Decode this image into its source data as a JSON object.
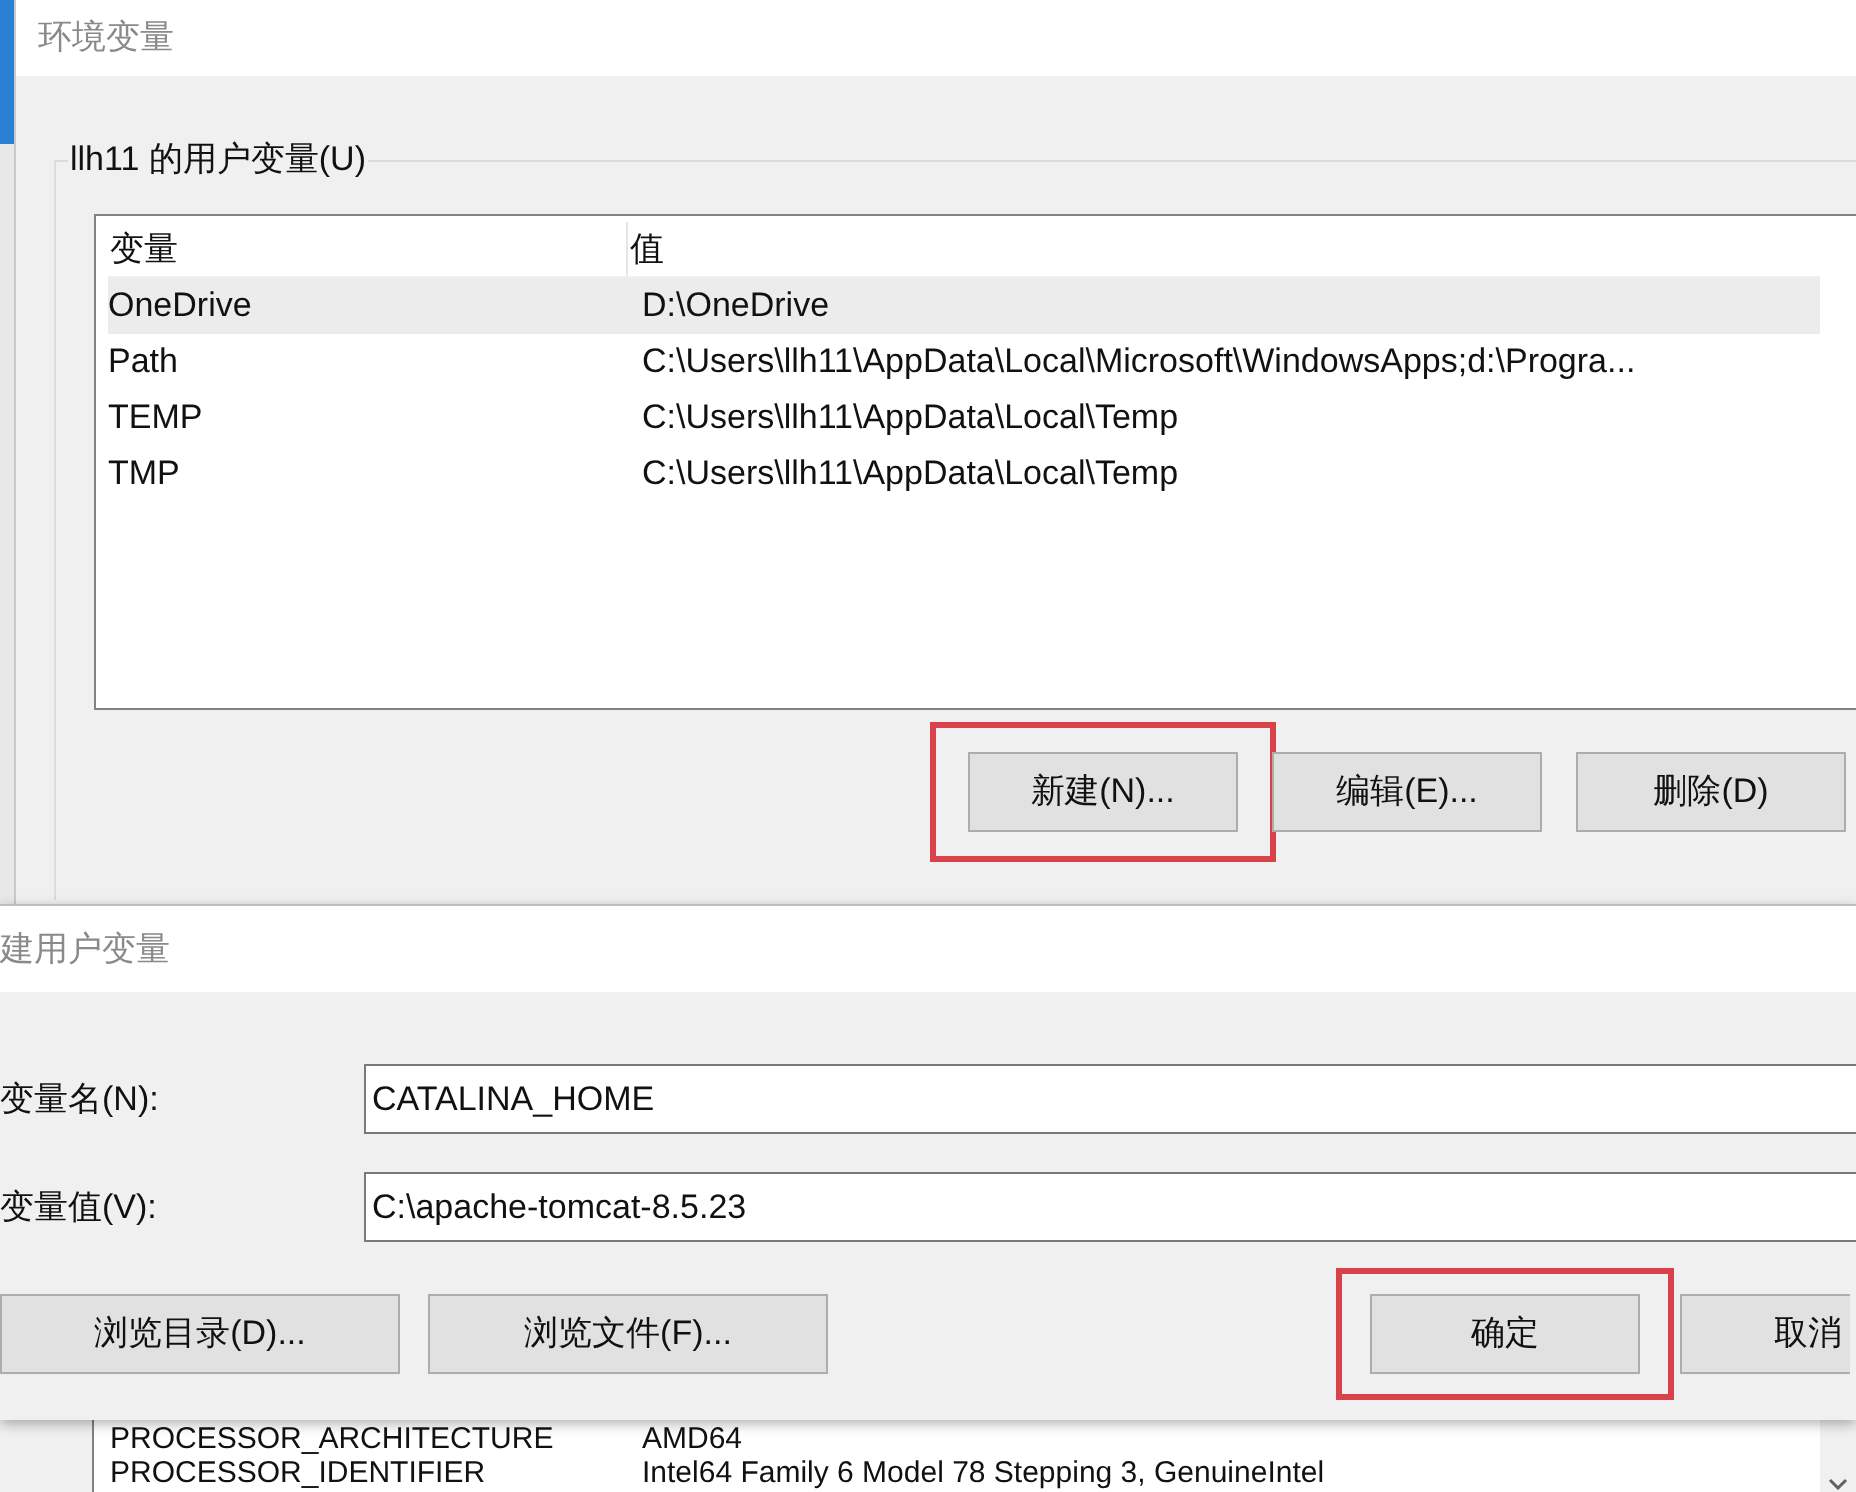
{
  "main_window": {
    "title": "环境变量",
    "group_label": "llh11 的用户变量(U)",
    "table": {
      "columns": [
        "变量",
        "值"
      ],
      "rows": [
        {
          "cells": [
            "OneDrive",
            "D:\\OneDrive"
          ],
          "selected": true
        },
        {
          "cells": [
            "Path",
            "C:\\Users\\llh11\\AppData\\Local\\Microsoft\\WindowsApps;d:\\Progra..."
          ],
          "selected": false
        },
        {
          "cells": [
            "TEMP",
            "C:\\Users\\llh11\\AppData\\Local\\Temp"
          ],
          "selected": false
        },
        {
          "cells": [
            "TMP",
            "C:\\Users\\llh11\\AppData\\Local\\Temp"
          ],
          "selected": false
        }
      ]
    },
    "buttons": [
      {
        "label": "新建(N)...",
        "highlighted": true
      },
      {
        "label": "编辑(E)...",
        "highlighted": false
      },
      {
        "label": "删除(D)",
        "highlighted": false
      }
    ]
  },
  "dialog": {
    "title": "建用户变量",
    "fields": [
      {
        "label": "变量名(N):",
        "value": "CATALINA_HOME"
      },
      {
        "label": "变量值(V):",
        "value": "C:\\apache-tomcat-8.5.23"
      }
    ],
    "browse_buttons": [
      {
        "label": "浏览目录(D)..."
      },
      {
        "label": "浏览文件(F)..."
      }
    ],
    "action_buttons": [
      {
        "label": "确定",
        "highlighted": true
      },
      {
        "label": "取消",
        "highlighted": false
      }
    ]
  },
  "background_list": {
    "rows": [
      {
        "cells": [
          "PROCESSOR_ARCHITECTURE",
          "AMD64"
        ]
      },
      {
        "cells": [
          "PROCESSOR_IDENTIFIER",
          "Intel64 Family 6 Model 78 Stepping 3, GenuineIntel"
        ]
      }
    ]
  }
}
